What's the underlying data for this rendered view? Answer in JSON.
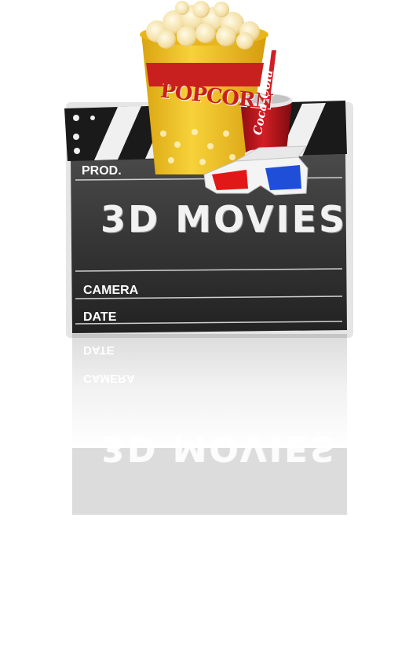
{
  "clapboard": {
    "prod_label": "PROD.",
    "title": "3D MOVIES",
    "camera_label": "CAMERA",
    "date_label": "DATE"
  },
  "popcorn": {
    "bucket_text": "POPCORN"
  },
  "soda": {
    "cup_text": "Coca-Cola"
  },
  "reflection": {
    "date_label": "DATE",
    "camera_label": "CAMERA",
    "title": "3D MOVIES"
  },
  "colors": {
    "board": "#3b3b3b",
    "popcorn_yellow": "#f2c21a",
    "popcorn_red": "#c8201e",
    "soda_red": "#b8141b",
    "glasses_red": "#e01818",
    "glasses_blue": "#1f4fd8"
  },
  "icons": [
    "clapboard-icon",
    "popcorn-bucket-icon",
    "soda-cup-icon",
    "3d-glasses-icon"
  ]
}
